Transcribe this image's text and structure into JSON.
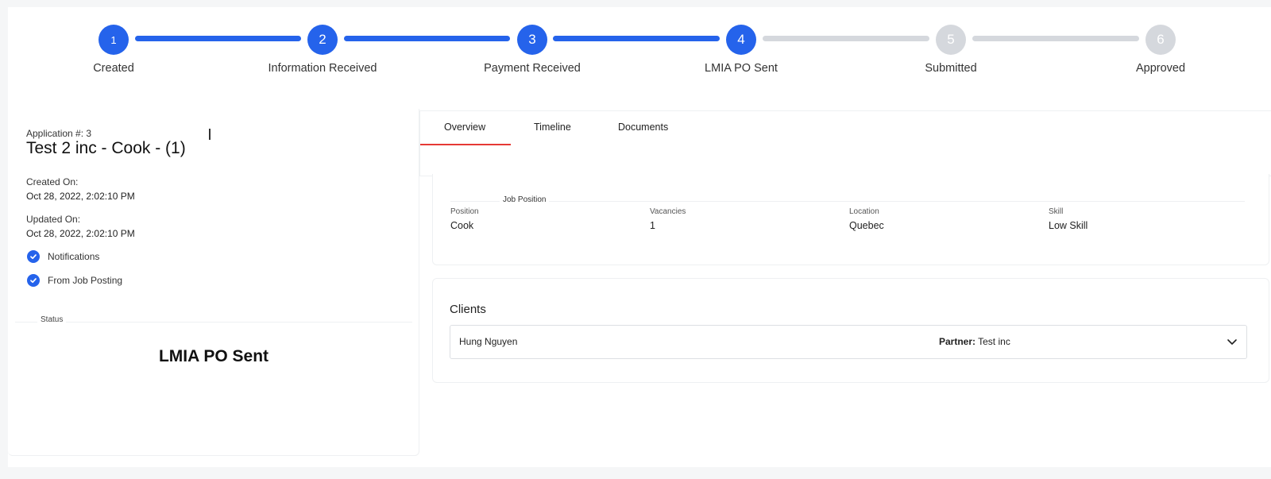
{
  "stepper": {
    "steps": [
      {
        "number": "1",
        "label": "Created",
        "state": "done"
      },
      {
        "number": "2",
        "label": "Information Received",
        "state": "done"
      },
      {
        "number": "3",
        "label": "Payment Received",
        "state": "done"
      },
      {
        "number": "4",
        "label": "LMIA PO Sent",
        "state": "current"
      },
      {
        "number": "5",
        "label": "Submitted",
        "state": "pending"
      },
      {
        "number": "6",
        "label": "Approved",
        "state": "pending"
      }
    ],
    "colors": {
      "done": "#2563eb",
      "pending": "#d5d8dd"
    }
  },
  "application": {
    "number_label": "Application #: 3",
    "title": "Test 2 inc - Cook - (1)",
    "created_label": "Created On:",
    "created_value": "Oct 28, 2022, 2:02:10 PM",
    "updated_label": "Updated On:",
    "updated_value": "Oct 28, 2022, 2:02:10 PM",
    "flags": [
      {
        "icon": "check-circle-icon",
        "label": "Notifications"
      },
      {
        "icon": "check-circle-icon",
        "label": "From Job Posting"
      }
    ],
    "status_legend": "Status",
    "status_value": "LMIA PO Sent"
  },
  "tabs": [
    {
      "label": "Overview",
      "active": true
    },
    {
      "label": "Timeline",
      "active": false
    },
    {
      "label": "Documents",
      "active": false
    }
  ],
  "job_position": {
    "legend": "Job Position",
    "fields": [
      {
        "label": "Position",
        "value": "Cook"
      },
      {
        "label": "Vacancies",
        "value": "1"
      },
      {
        "label": "Location",
        "value": "Quebec"
      },
      {
        "label": "Skill",
        "value": "Low Skill"
      }
    ]
  },
  "clients": {
    "title": "Clients",
    "rows": [
      {
        "name": "Hung Nguyen",
        "partner_label": "Partner:",
        "partner_value": " Test inc",
        "icon": "chevron-down-icon"
      }
    ]
  },
  "accent_color": "#e53935"
}
